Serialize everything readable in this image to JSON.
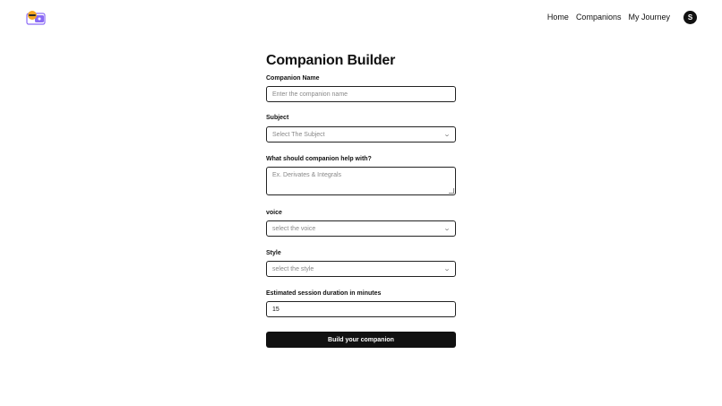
{
  "nav": {
    "logo": "logo-icon",
    "links": [
      "Home",
      "Companions",
      "My Journey"
    ],
    "avatar_initial": "S"
  },
  "form": {
    "title": "Companion Builder",
    "fields": {
      "name": {
        "label": "Companion Name",
        "placeholder": "Enter the companion name"
      },
      "subject": {
        "label": "Subject",
        "placeholder": "Select The Subject"
      },
      "topic": {
        "label": "What should companion help with?",
        "placeholder": "Ex. Derivates & Integrals"
      },
      "voice": {
        "label": "voice",
        "placeholder": "select the voice"
      },
      "style": {
        "label": "Style",
        "placeholder": "select the style"
      },
      "duration": {
        "label": "Estimated session duration in minutes",
        "value": "15"
      }
    },
    "submit_label": "Build your companion"
  },
  "colors": {
    "primary": "#111111",
    "logo_orange": "#f5a623",
    "logo_purple": "#8b6bf5"
  }
}
